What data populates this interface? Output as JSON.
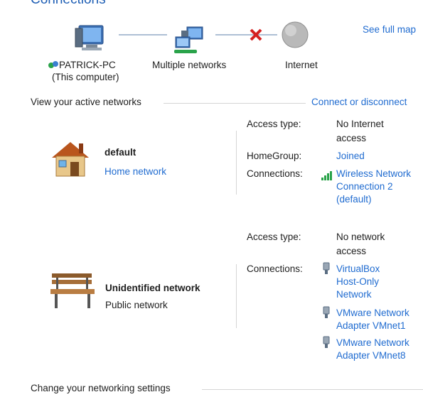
{
  "header": {
    "title": "Connections",
    "see_full_map": "See full map"
  },
  "map": {
    "computer_name": "PATRICK-PC",
    "computer_sub": "(This computer)",
    "networks_label": "Multiple networks",
    "internet_label": "Internet"
  },
  "active": {
    "heading": "View your active networks",
    "connect_link": "Connect or disconnect"
  },
  "networks": [
    {
      "name": "default",
      "type": "Home network",
      "access_label": "Access type:",
      "access_value_1": "No Internet",
      "access_value_2": "access",
      "homegroup_label": "HomeGroup:",
      "homegroup_value": "Joined",
      "connections_label": "Connections:",
      "connections": [
        "Wireless Network",
        "Connection 2",
        "(default)"
      ]
    },
    {
      "name": "Unidentified network",
      "type": "Public network",
      "access_label": "Access type:",
      "access_value_1": "No network",
      "access_value_2": "access",
      "connections_label": "Connections:",
      "connections": [
        [
          "VirtualBox",
          "Host-Only",
          "Network"
        ],
        [
          "VMware Network",
          "Adapter VMnet1"
        ],
        [
          "VMware Network",
          "Adapter VMnet8"
        ]
      ]
    }
  ],
  "footer": {
    "change_settings": "Change your networking settings"
  },
  "colors": {
    "link": "#1f6bd0",
    "heading": "#1f5fb5",
    "divider": "#d5d5d5",
    "error_x": "#d42020"
  }
}
